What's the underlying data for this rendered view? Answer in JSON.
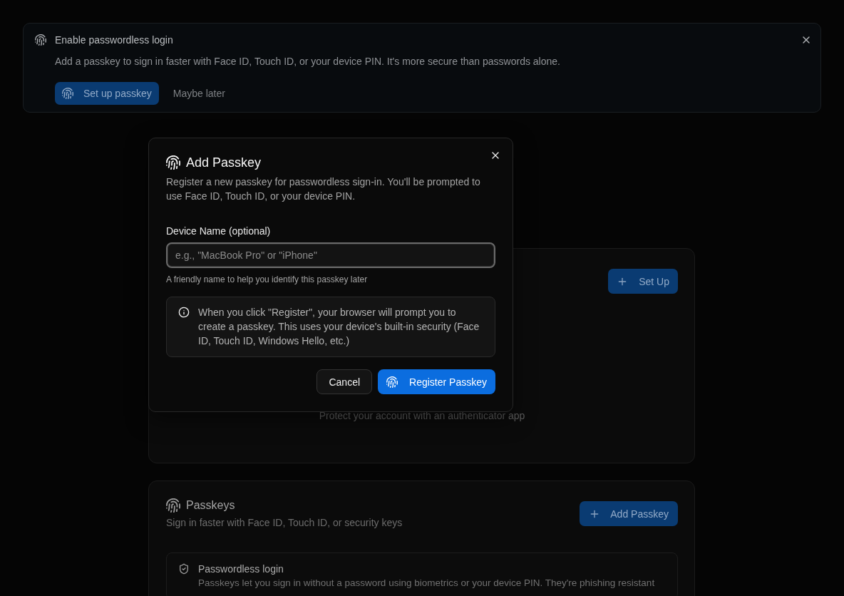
{
  "banner": {
    "title": "Enable passwordless login",
    "message": "Add a passkey to sign in faster with Face ID, Touch ID, or your device PIN. It's more secure than passwords alone.",
    "primary_button": "Set up passkey",
    "secondary_button": "Maybe later"
  },
  "authenticator_card": {
    "button": "Set Up",
    "caption": "Protect your account with an authenticator app"
  },
  "passkeys_card": {
    "title": "Passkeys",
    "subtitle": "Sign in faster with Face ID, Touch ID, or security keys",
    "button": "Add Passkey",
    "notice": {
      "title": "Passwordless login",
      "text": "Passkeys let you sign in without a password using biometrics or your device PIN. They're phishing resistant"
    }
  },
  "dialog": {
    "title": "Add Passkey",
    "description": "Register a new passkey for passwordless sign-in. You'll be prompted to use Face ID, Touch ID, or your device PIN.",
    "field": {
      "label": "Device Name (optional)",
      "placeholder": "e.g., \"MacBook Pro\" or \"iPhone\"",
      "focused": true,
      "hint": "A friendly name to help you identify this passkey later"
    },
    "info": "When you click \"Register\", your browser will prompt you to create a passkey. This uses your device's built-in security (Face ID, Touch ID, Windows Hello, etc.)",
    "buttons": [
      {
        "label": "Cancel",
        "kind": "secondary"
      },
      {
        "label": "Register Passkey",
        "kind": "primary"
      }
    ]
  }
}
